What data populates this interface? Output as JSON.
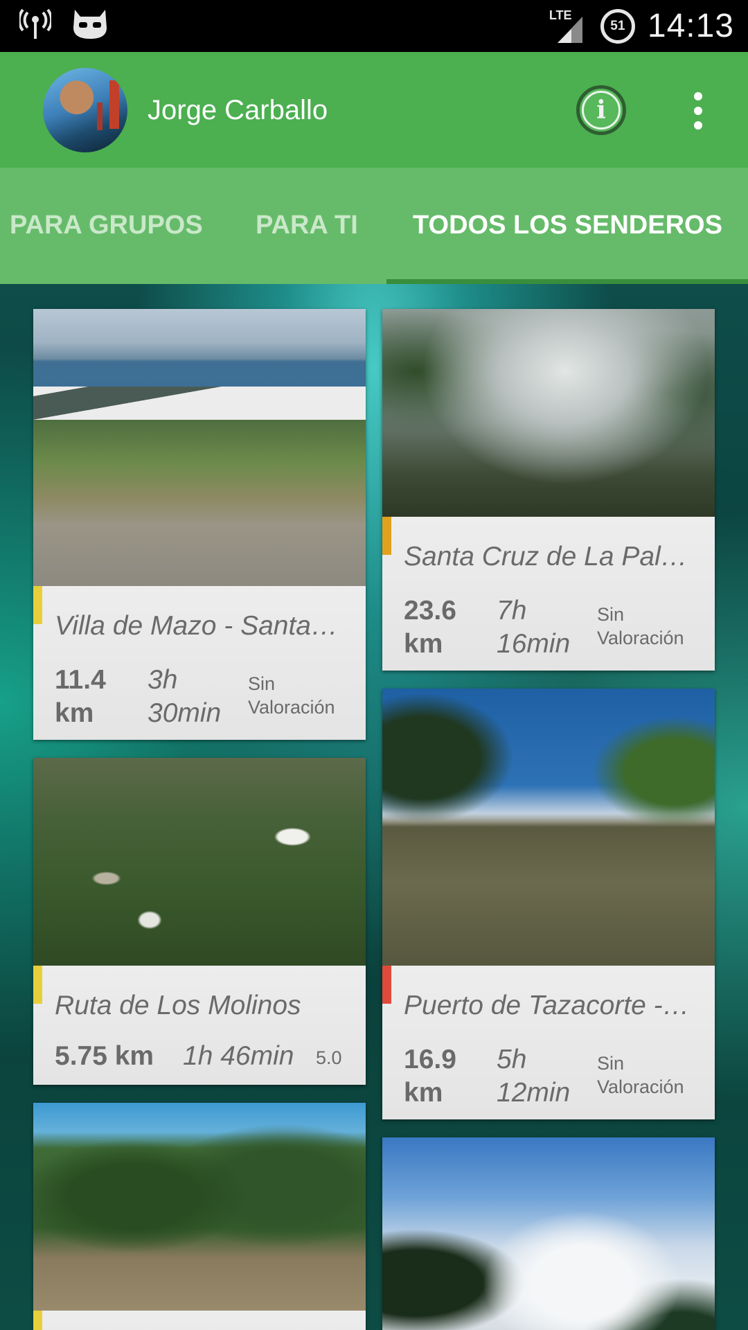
{
  "status_bar": {
    "time": "14:13",
    "battery_level": "51",
    "network": "LTE",
    "icons": [
      "signal-broadcast-icon",
      "cyanogenmod-icon",
      "lte-signal-icon",
      "battery-icon"
    ]
  },
  "toolbar": {
    "username": "Jorge Carballo",
    "icons": [
      "avatar",
      "info-icon",
      "overflow-menu-icon"
    ],
    "color": "#4caf50"
  },
  "tabs": [
    {
      "label": "PARA GRUPOS",
      "active": false
    },
    {
      "label": "PARA TI",
      "active": false
    },
    {
      "label": "TODOS LOS SENDEROS",
      "active": true
    }
  ],
  "tab_bar_color": "#66bb6a",
  "cards": [
    {
      "title": "Villa de Mazo - Santa…",
      "distance": "11.4\nkm",
      "time": "3h\n30min",
      "rating": "Sin\nValoración",
      "accent": "#e6cf3a"
    },
    {
      "title": "Santa Cruz de La Palm…",
      "distance": "23.6\nkm",
      "time": "7h\n16min",
      "rating": "Sin\nValoración",
      "accent": "#e0a21e"
    },
    {
      "title": "Ruta de Los Molinos",
      "distance": "5.75 km",
      "time": "1h 46min",
      "rating": "5.0",
      "accent": "#e6cf3a"
    },
    {
      "title": "Puerto de Tazacorte -…",
      "distance": "16.9\nkm",
      "time": "5h\n12min",
      "rating": "Sin\nValoración",
      "accent": "#e04a3a"
    },
    {
      "title": "",
      "distance": "",
      "time": "",
      "rating": "",
      "accent": "#e6cf3a"
    },
    {
      "title": "",
      "distance": "",
      "time": "",
      "rating": "",
      "accent": ""
    }
  ]
}
